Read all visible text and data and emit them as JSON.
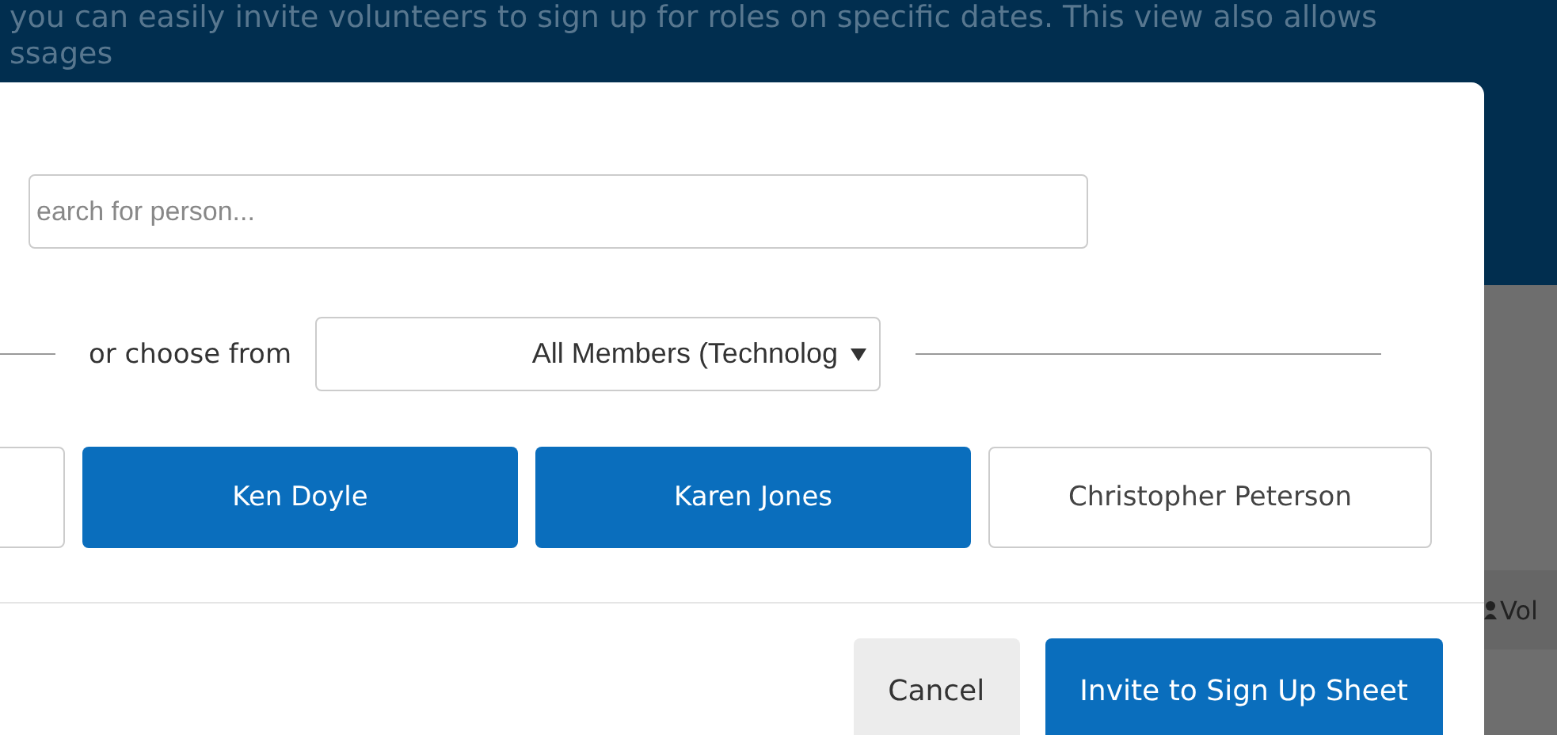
{
  "background": {
    "intro_lines": [
      "you can easily invite volunteers to sign up for roles on specific dates. This view also allows",
      "ssages"
    ],
    "table_label": "Vol"
  },
  "dialog": {
    "search": {
      "placeholder": "earch for person..."
    },
    "choose_label": "or choose from",
    "group_select": {
      "value": "All Members (Technolog"
    },
    "people": [
      {
        "selected": false
      },
      {
        "label": "Ken Doyle",
        "selected": true
      },
      {
        "label": "Karen Jones",
        "selected": true
      },
      {
        "label": "Christopher Peterson",
        "selected": false
      }
    ],
    "buttons": [
      {
        "label": "Cancel",
        "kind": "secondary"
      },
      {
        "label": "Invite to Sign Up Sheet",
        "kind": "primary"
      }
    ]
  }
}
